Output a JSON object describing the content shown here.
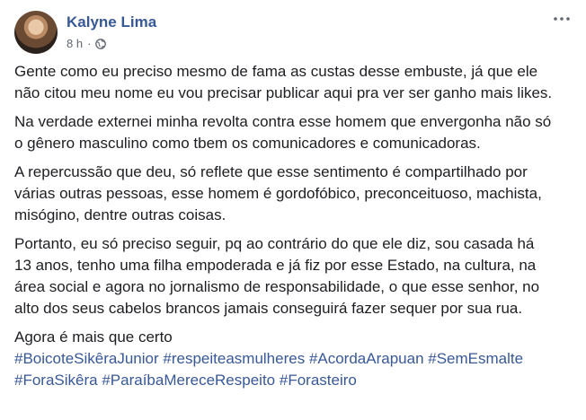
{
  "post": {
    "author": "Kalyne Lima",
    "time": "8 h",
    "separator": "·",
    "privacy_icon": "globe-icon",
    "menu_icon": "more-horizontal-icon",
    "paragraphs": [
      "Gente como eu preciso mesmo de fama as custas desse embuste, já que ele não citou meu nome eu vou precisar publicar aqui pra ver ser ganho mais likes.",
      "Na verdade externei minha revolta contra esse homem que envergonha não só o gênero masculino como tbem os comunicadores e comunicadoras.",
      "A repercussão que deu, só reflete que esse sentimento é compartilhado por várias outras pessoas, esse homem é gordofóbico, preconceituoso, machista, misógino, dentre outras coisas.",
      "Portanto, eu só preciso seguir, pq ao contrário do que ele diz, sou casada há 13 anos, tenho uma filha empoderada e já fiz por esse Estado, na cultura, na área social e agora no jornalismo de responsabilidade, o que esse senhor, no alto dos seus cabelos brancos jamais conseguirá fazer sequer por sua rua."
    ],
    "closing": "Agora é mais que certo",
    "hashtags": [
      "#BoicoteSikêraJunior",
      "#respeiteasmulheres",
      "#AcordaArapuan",
      "#SemEsmalte",
      "#ForaSikêra",
      "#ParaíbaMereceRespeito",
      "#Forasteiro"
    ],
    "colors": {
      "link": "#385898",
      "text": "#1c1e21",
      "meta": "#616770"
    }
  }
}
